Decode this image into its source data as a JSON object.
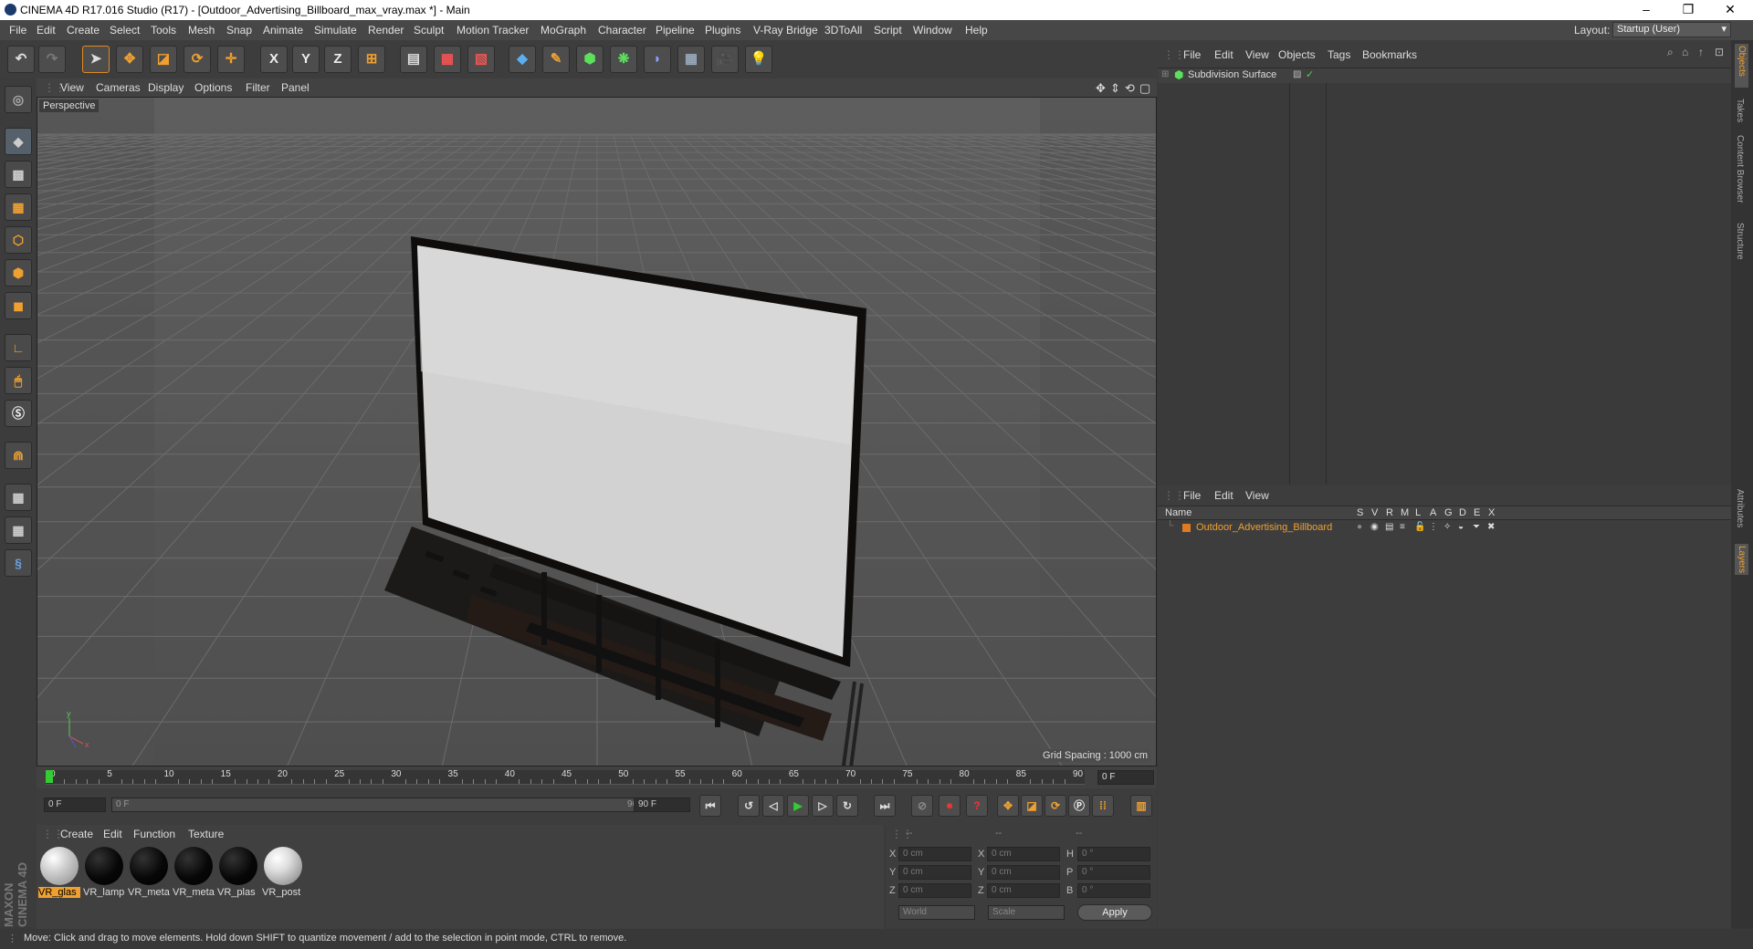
{
  "window": {
    "title": "CINEMA 4D R17.016 Studio (R17) - [Outdoor_Advertising_Billboard_max_vray.max *] - Main",
    "controls": [
      "–",
      "❐",
      "✕"
    ]
  },
  "menubar": {
    "items": [
      "File",
      "Edit",
      "Create",
      "Select",
      "Tools",
      "Mesh",
      "Snap",
      "Animate",
      "Simulate",
      "Render",
      "Sculpt",
      "Motion Tracker",
      "MoGraph",
      "Character",
      "Pipeline",
      "Plugins",
      "V-Ray Bridge",
      "3DToAll",
      "Script",
      "Window",
      "Help"
    ],
    "layout_label": "Layout:",
    "layout_value": "Startup (User)"
  },
  "toolbar": {
    "axis_x": "X",
    "axis_y": "Y",
    "axis_z": "Z"
  },
  "viewport": {
    "menu": [
      "View",
      "Cameras",
      "Display",
      "Options",
      "Filter",
      "Panel"
    ],
    "label": "Perspective",
    "grid_spacing": "Grid Spacing : 1000 cm"
  },
  "timeline": {
    "ticks": [
      "0",
      "5",
      "10",
      "15",
      "20",
      "25",
      "30",
      "35",
      "40",
      "45",
      "50",
      "55",
      "60",
      "65",
      "70",
      "75",
      "80",
      "85",
      "90"
    ],
    "end_frame": "0 F"
  },
  "transport": {
    "current_frame": "0 F",
    "range_start": "0 F",
    "range_end": "90 F",
    "max_frame": "90 F"
  },
  "materials": {
    "menu": [
      "Create",
      "Edit",
      "Function",
      "Texture"
    ],
    "items": [
      "VR_glas",
      "VR_lamp",
      "VR_meta",
      "VR_meta",
      "VR_plas",
      "VR_post"
    ],
    "colors": {
      "selected_label_bg": "#f0a030"
    }
  },
  "coordinates": {
    "header": [
      "--",
      "--",
      "--"
    ],
    "rows": [
      {
        "axis1": "X",
        "val1": "0 cm",
        "axis2": "X",
        "val2": "0 cm",
        "axis3": "H",
        "val3": "0 °"
      },
      {
        "axis1": "Y",
        "val1": "0 cm",
        "axis2": "Y",
        "val2": "0 cm",
        "axis3": "P",
        "val3": "0 °"
      },
      {
        "axis1": "Z",
        "val1": "0 cm",
        "axis2": "Z",
        "val2": "0 cm",
        "axis3": "B",
        "val3": "0 °"
      }
    ],
    "space": "World",
    "mode": "Scale",
    "apply": "Apply"
  },
  "objects": {
    "menu": [
      "File",
      "Edit",
      "View",
      "Objects",
      "Tags",
      "Bookmarks"
    ],
    "items": [
      {
        "name": "Subdivision Surface"
      }
    ]
  },
  "layers": {
    "menu": [
      "File",
      "Edit",
      "View"
    ],
    "columns": [
      "Name",
      "S",
      "V",
      "R",
      "M",
      "L",
      "A",
      "G",
      "D",
      "E",
      "X"
    ],
    "items": [
      {
        "name": "Outdoor_Advertising_Billboard",
        "color": "#e07b24"
      }
    ]
  },
  "side_tabs": [
    "Objects",
    "Takes",
    "Content Browser",
    "Structure",
    "Attributes",
    "Layers"
  ],
  "branding": {
    "text": "MAXON CINEMA 4D"
  },
  "status": "Move: Click and drag to move elements. Hold down SHIFT to quantize movement / add to the selection in point mode, CTRL to remove."
}
